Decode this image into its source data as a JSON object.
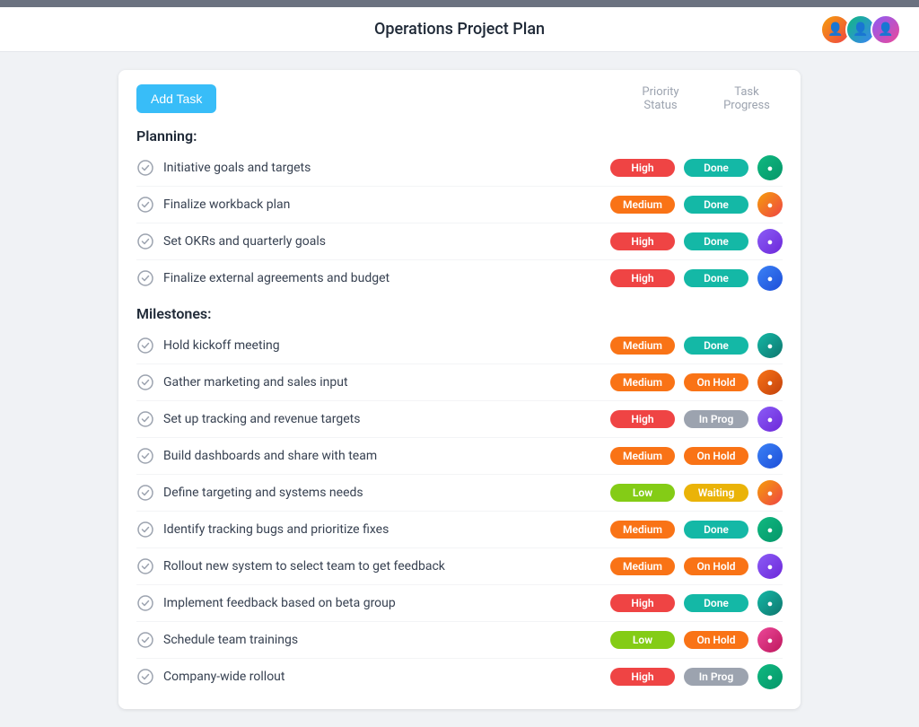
{
  "header": {
    "title": "Operations Project Plan",
    "avatars": [
      {
        "class": "av1",
        "label": "User 1"
      },
      {
        "class": "av2",
        "label": "User 2"
      },
      {
        "class": "av3",
        "label": "User 3"
      }
    ]
  },
  "toolbar": {
    "add_task_label": "Add Task",
    "col_priority": "Priority Status",
    "col_progress": "Task Progress"
  },
  "sections": [
    {
      "title": "Planning:",
      "tasks": [
        {
          "name": "Initiative goals and targets",
          "priority": "High",
          "priority_class": "badge-high",
          "status": "Done",
          "status_class": "badge-done",
          "avatar_class": "tav1"
        },
        {
          "name": "Finalize workback plan",
          "priority": "Medium",
          "priority_class": "badge-medium",
          "status": "Done",
          "status_class": "badge-done",
          "avatar_class": "tav2"
        },
        {
          "name": "Set OKRs and quarterly goals",
          "priority": "High",
          "priority_class": "badge-high",
          "status": "Done",
          "status_class": "badge-done",
          "avatar_class": "tav3"
        },
        {
          "name": "Finalize external agreements and budget",
          "priority": "High",
          "priority_class": "badge-high",
          "status": "Done",
          "status_class": "badge-done",
          "avatar_class": "tav4"
        }
      ]
    },
    {
      "title": "Milestones:",
      "tasks": [
        {
          "name": "Hold kickoff meeting",
          "priority": "Medium",
          "priority_class": "badge-medium",
          "status": "Done",
          "status_class": "badge-done",
          "avatar_class": "tav7"
        },
        {
          "name": "Gather marketing and sales input",
          "priority": "Medium",
          "priority_class": "badge-medium",
          "status": "On Hold",
          "status_class": "badge-on-hold",
          "avatar_class": "tav6"
        },
        {
          "name": "Set up tracking and revenue targets",
          "priority": "High",
          "priority_class": "badge-high",
          "status": "In Prog",
          "status_class": "badge-in-prog",
          "avatar_class": "tav3"
        },
        {
          "name": "Build dashboards and share with team",
          "priority": "Medium",
          "priority_class": "badge-medium",
          "status": "On Hold",
          "status_class": "badge-on-hold",
          "avatar_class": "tav4"
        },
        {
          "name": "Define targeting and systems needs",
          "priority": "Low",
          "priority_class": "badge-low",
          "status": "Waiting",
          "status_class": "badge-waiting",
          "avatar_class": "tav2"
        },
        {
          "name": "Identify tracking bugs and prioritize fixes",
          "priority": "Medium",
          "priority_class": "badge-medium",
          "status": "Done",
          "status_class": "badge-done",
          "avatar_class": "tav1"
        },
        {
          "name": "Rollout new system to select team to get feedback",
          "priority": "Medium",
          "priority_class": "badge-medium",
          "status": "On Hold",
          "status_class": "badge-on-hold",
          "avatar_class": "tav3"
        },
        {
          "name": "Implement feedback based on beta group",
          "priority": "High",
          "priority_class": "badge-high",
          "status": "Done",
          "status_class": "badge-done",
          "avatar_class": "tav7"
        },
        {
          "name": "Schedule team trainings",
          "priority": "Low",
          "priority_class": "badge-low",
          "status": "On Hold",
          "status_class": "badge-on-hold",
          "avatar_class": "tav5"
        },
        {
          "name": "Company-wide rollout",
          "priority": "High",
          "priority_class": "badge-high",
          "status": "In Prog",
          "status_class": "badge-in-prog",
          "avatar_class": "tav1"
        }
      ]
    }
  ]
}
